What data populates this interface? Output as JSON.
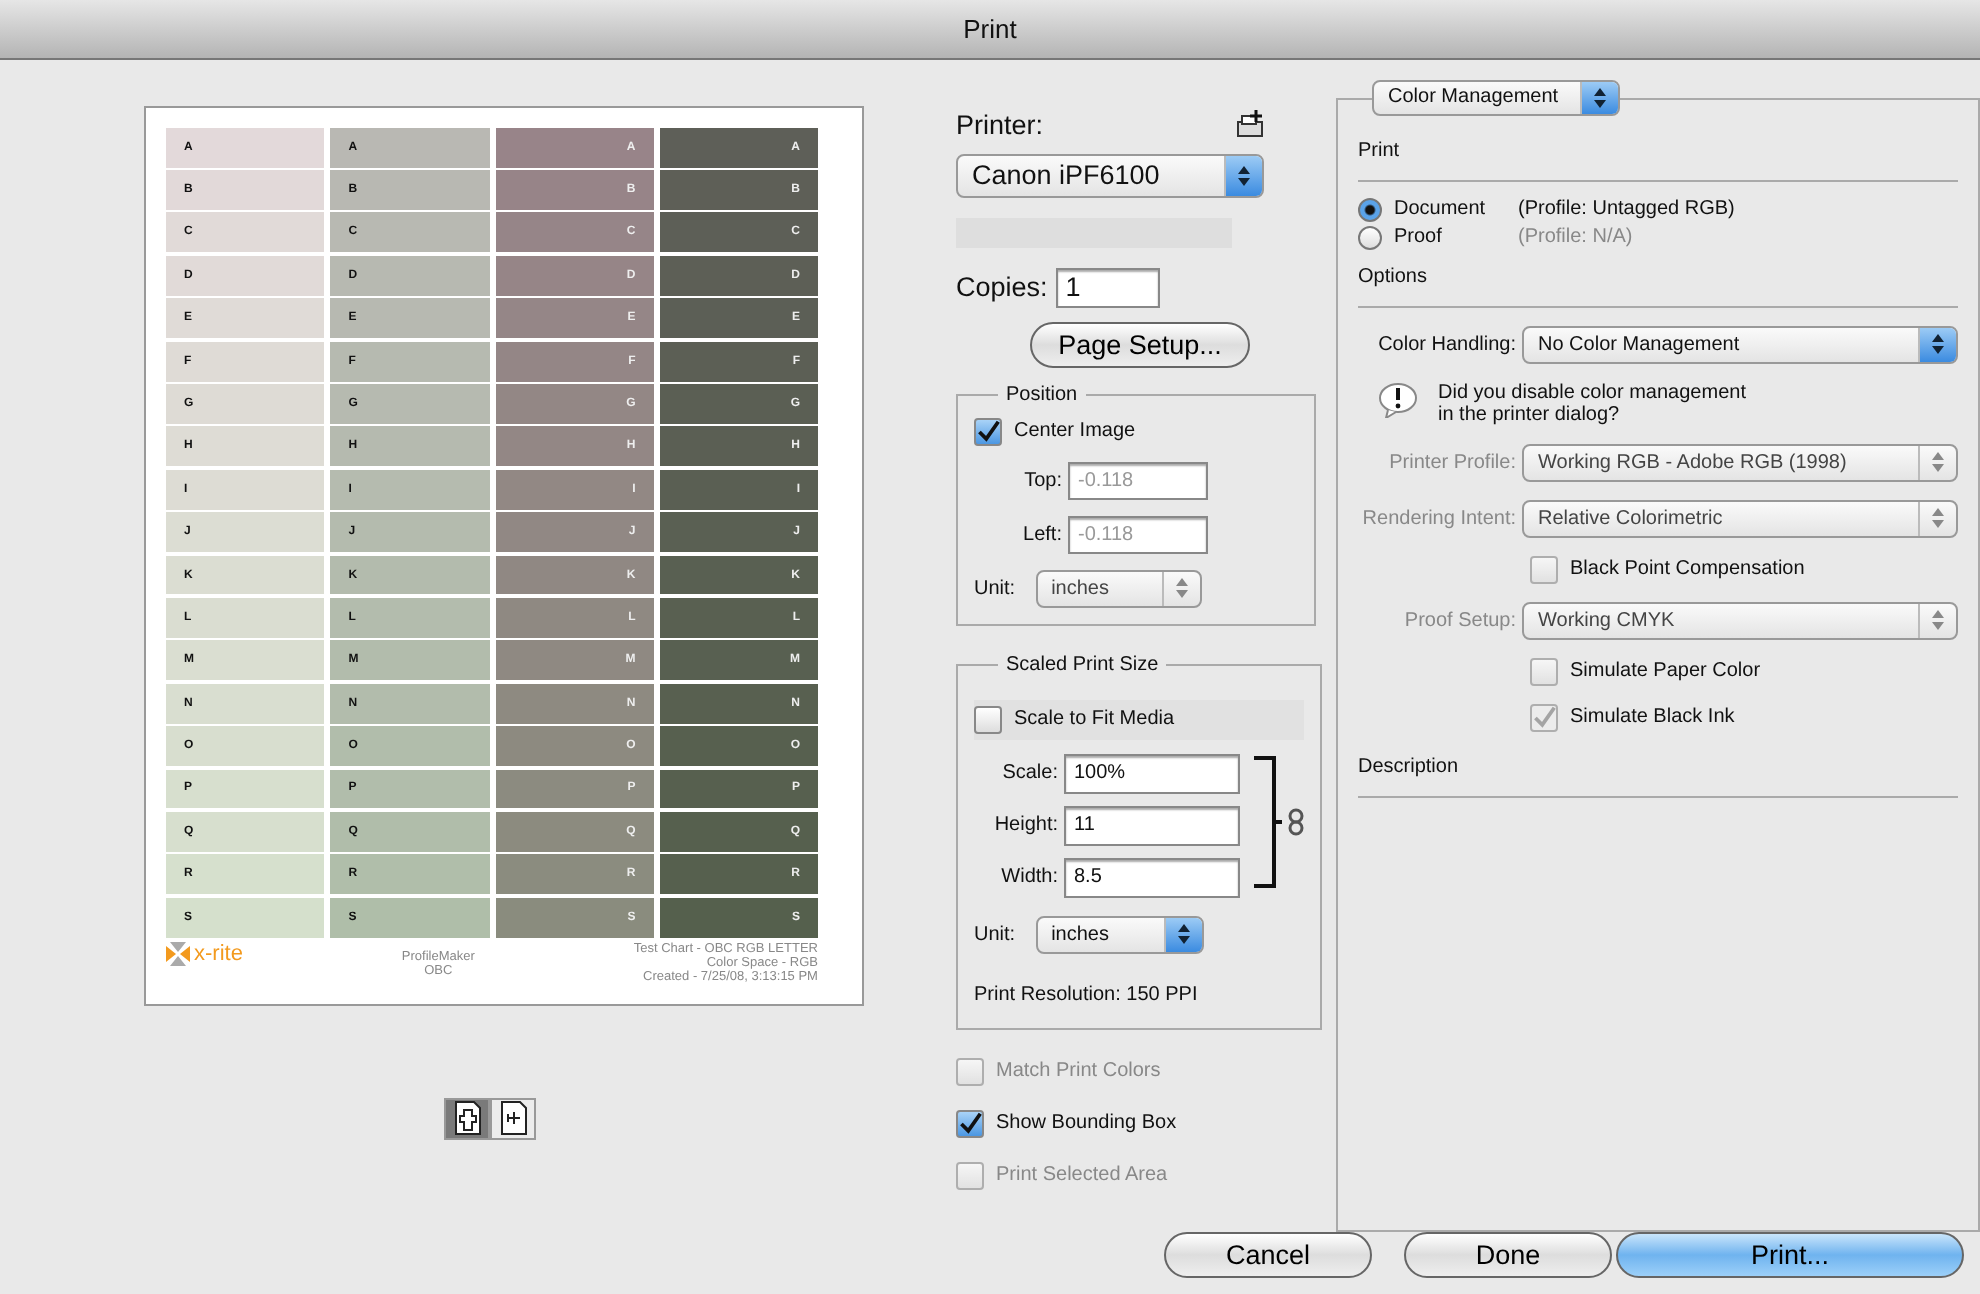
{
  "window": {
    "title": "Print"
  },
  "preview": {
    "columns": [
      {
        "kind": "dark",
        "cells": [
          "A",
          "B",
          "C",
          "D",
          "E",
          "F",
          "G",
          "H",
          "I",
          "J",
          "K",
          "L",
          "M",
          "N",
          "O",
          "P",
          "Q",
          "R",
          "S"
        ]
      },
      {
        "kind": "dark",
        "cells": [
          "A",
          "B",
          "C",
          "D",
          "E",
          "F",
          "G",
          "H",
          "I",
          "J",
          "K",
          "L",
          "M",
          "N",
          "O",
          "P",
          "Q",
          "R",
          "S"
        ]
      },
      {
        "kind": "light",
        "cells": [
          "A",
          "B",
          "C",
          "D",
          "E",
          "F",
          "G",
          "H",
          "I",
          "J",
          "K",
          "L",
          "M",
          "N",
          "O",
          "P",
          "Q",
          "R",
          "S"
        ]
      },
      {
        "kind": "light",
        "cells": [
          "A",
          "B",
          "C",
          "D",
          "E",
          "F",
          "G",
          "H",
          "I",
          "J",
          "K",
          "L",
          "M",
          "N",
          "O",
          "P",
          "Q",
          "R",
          "S"
        ]
      }
    ],
    "logo": "x-rite",
    "center_lines": [
      "ProfileMaker",
      "OBC"
    ],
    "right_lines": [
      "Test Chart - OBC RGB LETTER",
      "Color Space - RGB",
      "Created - 7/25/08, 3:13:15 PM"
    ]
  },
  "view_buttons": [
    {
      "selected": true
    },
    {
      "selected": false
    }
  ],
  "printer": {
    "label": "Printer:",
    "value": "Canon iPF6100"
  },
  "copies": {
    "label": "Copies:",
    "value": "1"
  },
  "page_setup_button": "Page Setup...",
  "position": {
    "title": "Position",
    "center_image": {
      "label": "Center Image",
      "checked": true
    },
    "fields": [
      {
        "label": "Top:",
        "value": "-0.118",
        "disabled": true
      },
      {
        "label": "Left:",
        "value": "-0.118",
        "disabled": true
      }
    ],
    "unit": {
      "label": "Unit:",
      "value": "inches",
      "disabled": true
    }
  },
  "scaled_print_size": {
    "title": "Scaled Print Size",
    "scale_to_fit": {
      "label": "Scale to Fit Media",
      "checked": false
    },
    "fields": [
      {
        "label": "Scale:",
        "value": "100%"
      },
      {
        "label": "Height:",
        "value": "11"
      },
      {
        "label": "Width:",
        "value": "8.5"
      }
    ],
    "unit": {
      "label": "Unit:",
      "value": "inches",
      "disabled": false
    },
    "resolution": "Print Resolution: 150 PPI"
  },
  "options": [
    {
      "label": "Match Print Colors",
      "checked": false,
      "disabled": true
    },
    {
      "label": "Show Bounding Box",
      "checked": true,
      "disabled": false
    },
    {
      "label": "Print Selected Area",
      "checked": false,
      "disabled": true
    }
  ],
  "color_management": {
    "section": "Color Management",
    "print_heading": "Print",
    "sources": [
      {
        "label": "Document",
        "profile": "(Profile: Untagged RGB)",
        "selected": true
      },
      {
        "label": "Proof",
        "profile": "(Profile: N/A)",
        "selected": false
      }
    ],
    "options_heading": "Options",
    "rows": [
      {
        "kind": "select",
        "label": "Color Handling:",
        "value": "No Color Management",
        "disabled": false
      },
      {
        "kind": "warning",
        "text": "Did you disable color management\nin the printer dialog?"
      },
      {
        "kind": "select",
        "label": "Printer Profile:",
        "value": "Working RGB - Adobe RGB (1998)",
        "disabled": true
      },
      {
        "kind": "select",
        "label": "Rendering Intent:",
        "value": "Relative Colorimetric",
        "disabled": true
      },
      {
        "kind": "checkbox",
        "label": "Black Point Compensation",
        "checked": false,
        "disabled": true
      },
      {
        "kind": "select",
        "label": "Proof Setup:",
        "value": "Working CMYK",
        "disabled": true
      },
      {
        "kind": "checkbox",
        "label": "Simulate Paper Color",
        "checked": false,
        "disabled": true
      },
      {
        "kind": "checkbox",
        "label": "Simulate Black Ink",
        "checked": true,
        "disabled": true
      }
    ],
    "description_heading": "Description"
  },
  "buttons": [
    {
      "label": "Cancel",
      "kind": "normal"
    },
    {
      "label": "Done",
      "kind": "normal"
    },
    {
      "label": "Print...",
      "kind": "default"
    }
  ]
}
